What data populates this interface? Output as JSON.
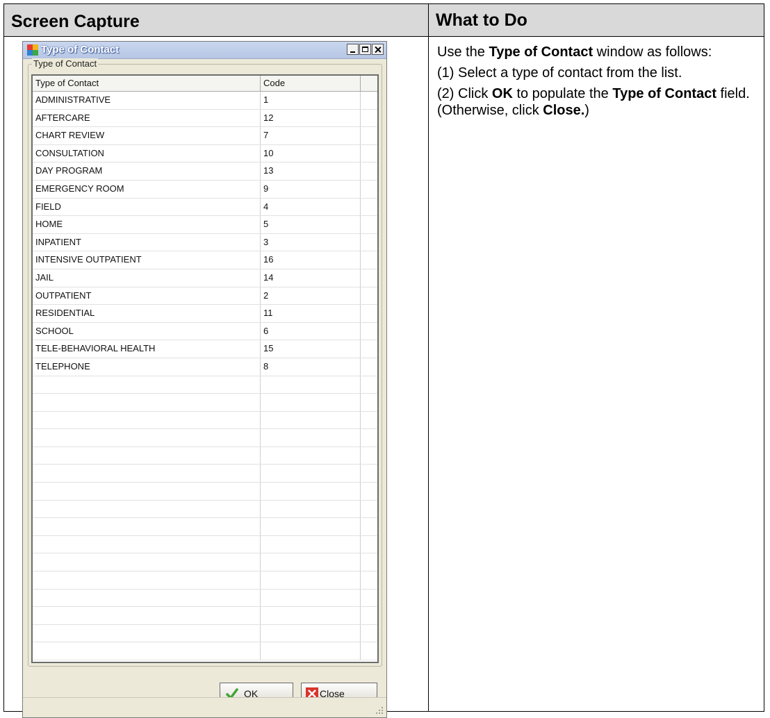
{
  "headers": {
    "left": "Screen Capture",
    "right": "What to Do"
  },
  "window": {
    "title": "Type of Contact",
    "group_label": "Type of Contact",
    "columns": [
      "Type of Contact",
      "Code"
    ],
    "rows": [
      [
        "ADMINISTRATIVE",
        "1"
      ],
      [
        "AFTERCARE",
        "12"
      ],
      [
        "CHART REVIEW",
        "7"
      ],
      [
        "CONSULTATION",
        "10"
      ],
      [
        "DAY PROGRAM",
        "13"
      ],
      [
        "EMERGENCY ROOM",
        "9"
      ],
      [
        "FIELD",
        "4"
      ],
      [
        "HOME",
        "5"
      ],
      [
        "INPATIENT",
        "3"
      ],
      [
        "INTENSIVE OUTPATIENT",
        "16"
      ],
      [
        "JAIL",
        "14"
      ],
      [
        "OUTPATIENT",
        "2"
      ],
      [
        "RESIDENTIAL",
        "11"
      ],
      [
        "SCHOOL",
        "6"
      ],
      [
        "TELE-BEHAVIORAL HEALTH",
        "15"
      ],
      [
        "TELEPHONE",
        "8"
      ]
    ],
    "empty_rows": 16,
    "ok_label": "OK",
    "close_label": "Close"
  },
  "instructions": {
    "p1_pre": "Use the ",
    "p1_bold": "Type of Contact",
    "p1_post": " window as follows:",
    "p2": "(1) Select a type of contact from the list.",
    "p3_a": "(2) Click ",
    "p3_b": "OK",
    "p3_c": " to populate the ",
    "p3_d": "Type of Contact",
    "p3_e": " field. (Otherwise, click ",
    "p3_f": "Close.",
    "p3_g": ")"
  }
}
